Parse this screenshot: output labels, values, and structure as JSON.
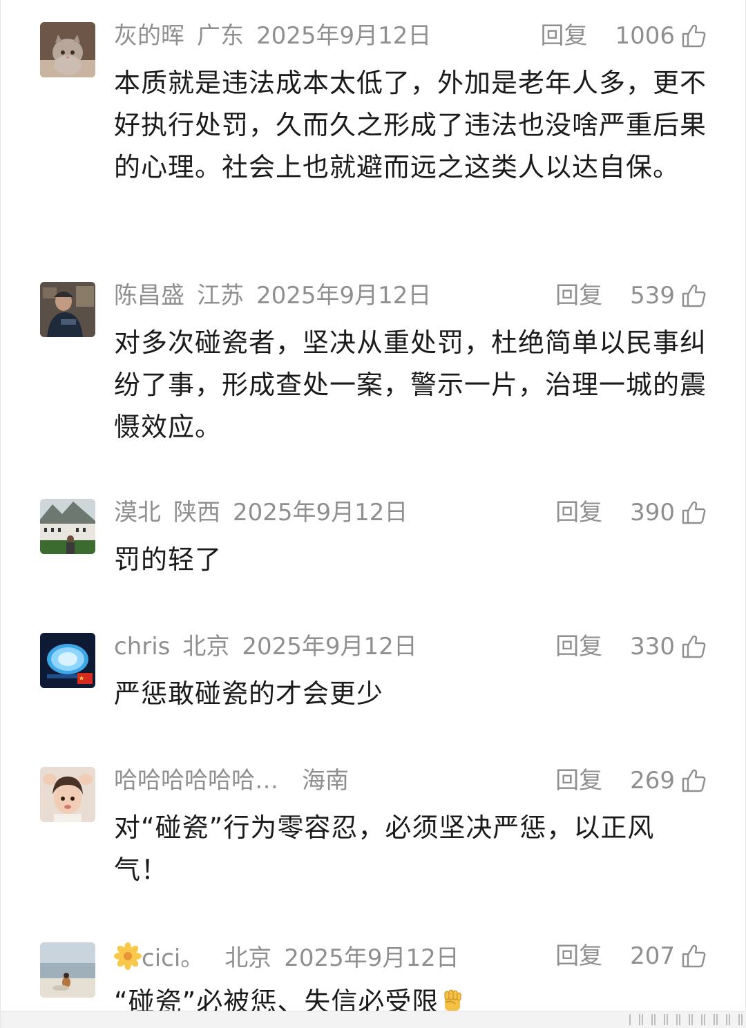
{
  "comments": [
    {
      "user": "灰的晖",
      "location": "广东",
      "date": "2025年9月12日",
      "reply_label": "回复",
      "likes": "1006",
      "text": "本质就是违法成本太低了，外加是老年人多，更不好执行处罚，久而久之形成了违法也没啥严重后果的心理。社会上也就避而远之这类人以达自保。",
      "avatar": "kitten-photo"
    },
    {
      "user": "陈昌盛",
      "location": "江苏",
      "date": "2025年9月12日",
      "reply_label": "回复",
      "likes": "539",
      "text": "对多次碰瓷者，坚决从重处罚，杜绝简单以民事纠纷了事，形成查处一案，警示一片，治理一城的震慑效应。",
      "avatar": "man-photo"
    },
    {
      "user": "漠北",
      "location": "陕西",
      "date": "2025年9月12日",
      "reply_label": "回复",
      "likes": "390",
      "text": "罚的轻了",
      "avatar": "landscape-photo"
    },
    {
      "user": "chris",
      "location": "北京",
      "date": "2025年9月12日",
      "reply_label": "回复",
      "likes": "330",
      "text": "严惩敢碰瓷的才会更少",
      "avatar": "lantern-photo"
    },
    {
      "user": "哈哈哈哈哈哈…",
      "location": "海南",
      "date": "",
      "reply_label": "回复",
      "likes": "269",
      "text": "对“碰瓷”行为零容忍，必须坚决严惩，以正风气！",
      "avatar": "child-photo"
    },
    {
      "user": "cici。",
      "location": "北京",
      "date": "2025年9月12日",
      "reply_label": "回复",
      "likes": "207",
      "text": "“碰瓷”必被惩、失信必受限",
      "avatar": "beach-photo",
      "user_prefix_icon": "flower-icon",
      "text_suffix_icon": "raised-fist-icon"
    }
  ],
  "colors": {
    "meta_gray": "#8f8f8f",
    "body_text": "#1a1a1a",
    "background": "#ffffff"
  }
}
